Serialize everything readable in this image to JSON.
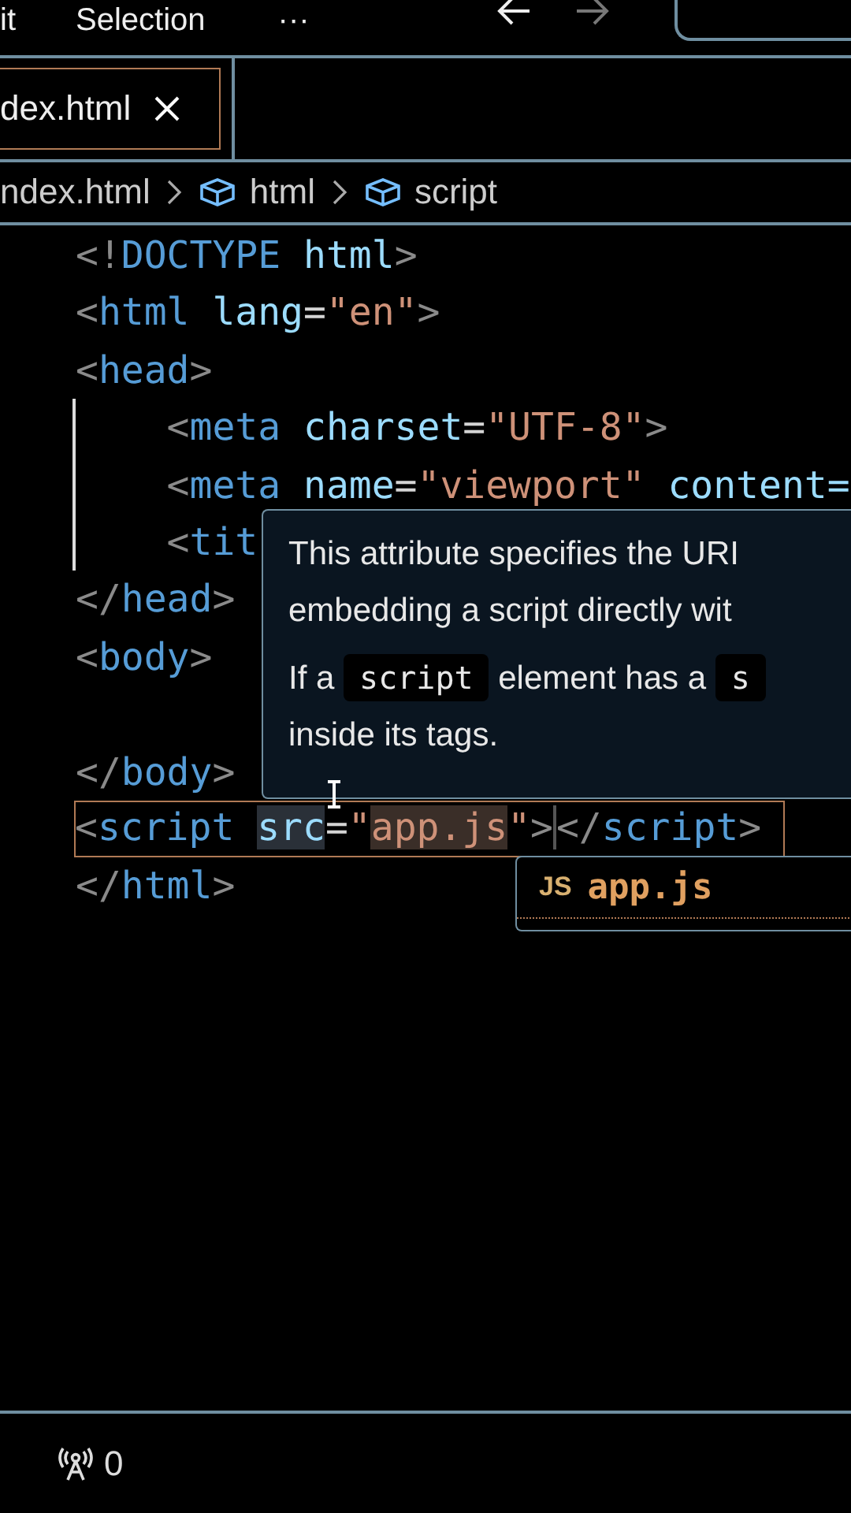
{
  "menu_bar": {
    "items": [
      "it",
      "Selection",
      "···"
    ]
  },
  "nav_buttons": [
    {
      "kind": "back",
      "disabled": false
    },
    {
      "kind": "forward",
      "disabled": true
    }
  ],
  "tabs": [
    {
      "label": "dex.html",
      "selected": true
    }
  ],
  "breadcrumb": [
    {
      "label": "ndex.html",
      "kind": "file"
    },
    {
      "label": "html",
      "kind": "element"
    },
    {
      "label": "script",
      "kind": "element"
    }
  ],
  "editor": {
    "lines": [
      {
        "kind": "code",
        "tokens": [
          {
            "kind": "punct",
            "text": "<!"
          },
          {
            "kind": "tag",
            "text": "DOCTYPE"
          },
          {
            "kind": "attr",
            "text": " html"
          },
          {
            "kind": "punct",
            "text": ">"
          }
        ]
      },
      {
        "kind": "code",
        "tokens": [
          {
            "kind": "punct",
            "text": "<"
          },
          {
            "kind": "tag",
            "text": "html"
          },
          {
            "kind": "attr",
            "text": " lang"
          },
          {
            "kind": "plain",
            "text": "="
          },
          {
            "kind": "string",
            "text": "\"en\""
          },
          {
            "kind": "punct",
            "text": ">"
          }
        ]
      },
      {
        "kind": "code",
        "tokens": [
          {
            "kind": "punct",
            "text": "<"
          },
          {
            "kind": "tag",
            "text": "head"
          },
          {
            "kind": "punct",
            "text": ">"
          }
        ]
      },
      {
        "kind": "code",
        "indent_guide": true,
        "tokens": [
          {
            "kind": "punct",
            "text": "    <"
          },
          {
            "kind": "tag",
            "text": "meta"
          },
          {
            "kind": "attr",
            "text": " charset"
          },
          {
            "kind": "plain",
            "text": "="
          },
          {
            "kind": "string",
            "text": "\"UTF-8\""
          },
          {
            "kind": "punct",
            "text": ">"
          }
        ]
      },
      {
        "kind": "code",
        "indent_guide": true,
        "tokens": [
          {
            "kind": "punct",
            "text": "    <"
          },
          {
            "kind": "tag",
            "text": "meta"
          },
          {
            "kind": "attr",
            "text": " name"
          },
          {
            "kind": "plain",
            "text": "="
          },
          {
            "kind": "string",
            "text": "\"viewport\""
          },
          {
            "kind": "attr",
            "text": " content="
          }
        ]
      },
      {
        "kind": "code",
        "indent_guide": true,
        "tokens": [
          {
            "kind": "punct",
            "text": "    <"
          },
          {
            "kind": "tag",
            "text": "tit"
          }
        ]
      },
      {
        "kind": "code",
        "tokens": [
          {
            "kind": "punct",
            "text": "</"
          },
          {
            "kind": "tag",
            "text": "head"
          },
          {
            "kind": "punct",
            "text": ">"
          }
        ]
      },
      {
        "kind": "code",
        "tokens": [
          {
            "kind": "punct",
            "text": "<"
          },
          {
            "kind": "tag",
            "text": "body"
          },
          {
            "kind": "punct",
            "text": ">"
          }
        ]
      },
      {
        "kind": "blank"
      },
      {
        "kind": "code",
        "tokens": [
          {
            "kind": "punct",
            "text": "</"
          },
          {
            "kind": "tag",
            "text": "body"
          },
          {
            "kind": "punct",
            "text": ">"
          }
        ]
      },
      {
        "kind": "code",
        "selected": true,
        "tokens": [
          {
            "kind": "punct",
            "text": "<"
          },
          {
            "kind": "tag",
            "text": "script "
          },
          {
            "kind": "attr",
            "text": "src",
            "highlighted": true
          },
          {
            "kind": "plain",
            "text": "="
          },
          {
            "kind": "string",
            "text": "\""
          },
          {
            "kind": "string",
            "text": "app.js",
            "highlighted": true
          },
          {
            "kind": "string",
            "text": "\""
          },
          {
            "kind": "punct",
            "text": ">",
            "caret": true
          },
          {
            "kind": "punct",
            "text": "</"
          },
          {
            "kind": "tag",
            "text": "script"
          },
          {
            "kind": "punct",
            "text": ">"
          }
        ]
      },
      {
        "kind": "code",
        "tokens": [
          {
            "kind": "punct",
            "text": "</"
          },
          {
            "kind": "tag",
            "text": "html"
          },
          {
            "kind": "punct",
            "text": ">"
          }
        ]
      }
    ]
  },
  "hover": {
    "paragraphs": [
      {
        "lines": [
          [
            {
              "kind": "text",
              "text": "This attribute specifies the URI"
            }
          ],
          [
            {
              "kind": "text",
              "text": "embedding a script directly wit"
            }
          ]
        ]
      },
      {
        "lines": [
          [
            {
              "kind": "text",
              "text": "If a "
            },
            {
              "kind": "code",
              "text": "script"
            },
            {
              "kind": "text",
              "text": " element has a "
            },
            {
              "kind": "code",
              "text": "s"
            }
          ],
          [
            {
              "kind": "text",
              "text": "inside its tags."
            }
          ]
        ]
      }
    ]
  },
  "suggestions": [
    {
      "icon": "JS",
      "label": "app.js",
      "selected": true
    }
  ],
  "status_bar": {
    "items": [
      {
        "kind": "ports",
        "text": "0"
      }
    ]
  }
}
